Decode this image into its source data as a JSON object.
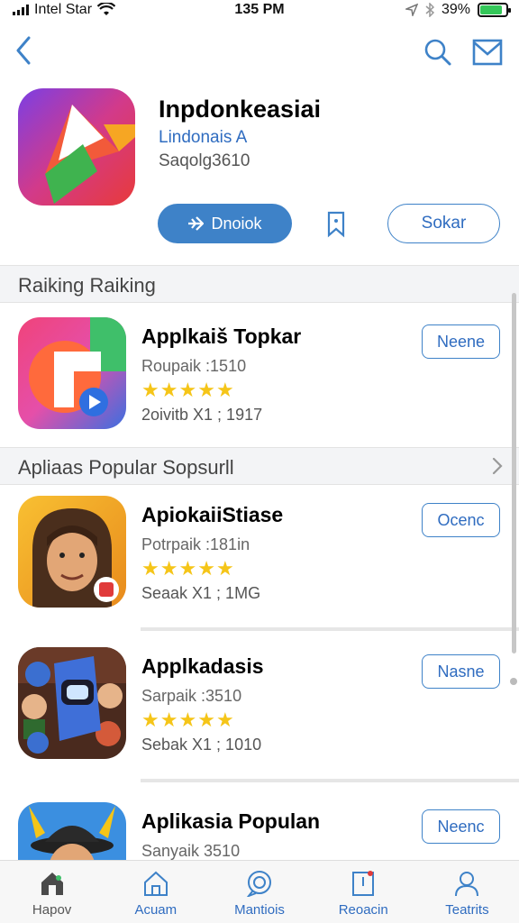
{
  "status_bar": {
    "carrier": "Intel Star",
    "time": "135 PM",
    "battery_percent": "39%",
    "battery_level": 0.85
  },
  "hero": {
    "title": "Inpdonkeasiai",
    "developer": "Lindonais A",
    "meta": "Saqolg3610",
    "get_label": "Dnoiok",
    "share_label": "Sokar"
  },
  "sections": [
    {
      "label": "Raiking Raiking"
    },
    {
      "label": "Apliaas Popular  Sopsurll"
    }
  ],
  "apps": [
    {
      "name": "Applkaiš Topkar",
      "subtitle": "Roupaik :1510",
      "rating": 4.5,
      "count": "2oivitb X1 ; 1917",
      "button": "Neene"
    },
    {
      "name": "ApiokaiiStiase",
      "subtitle": "Potrpaik :181in",
      "rating": 4.5,
      "count": "Seaak X1 ; 1MG",
      "button": "Ocenc"
    },
    {
      "name": "Applkadasis",
      "subtitle": "Sarpaik :3510",
      "rating": 4.5,
      "count": "Sebak X1 ; 1010",
      "button": "Nasne"
    },
    {
      "name": "Aplikasia Populan",
      "subtitle": "Sanyaik  3510",
      "rating": 4.5,
      "count": "",
      "button": "Neenc"
    }
  ],
  "tabs": [
    {
      "label": "Hapov",
      "icon": "house-icon"
    },
    {
      "label": "Acuam",
      "icon": "home-outline-icon"
    },
    {
      "label": "Mantiois",
      "icon": "chat-icon"
    },
    {
      "label": "Reoacin",
      "icon": "document-icon"
    },
    {
      "label": "Teatrits",
      "icon": "person-icon"
    }
  ],
  "colors": {
    "accent": "#3e82c8",
    "link": "#2f6cc0",
    "star": "#f5c518",
    "section_bg": "#f3f4f6"
  }
}
